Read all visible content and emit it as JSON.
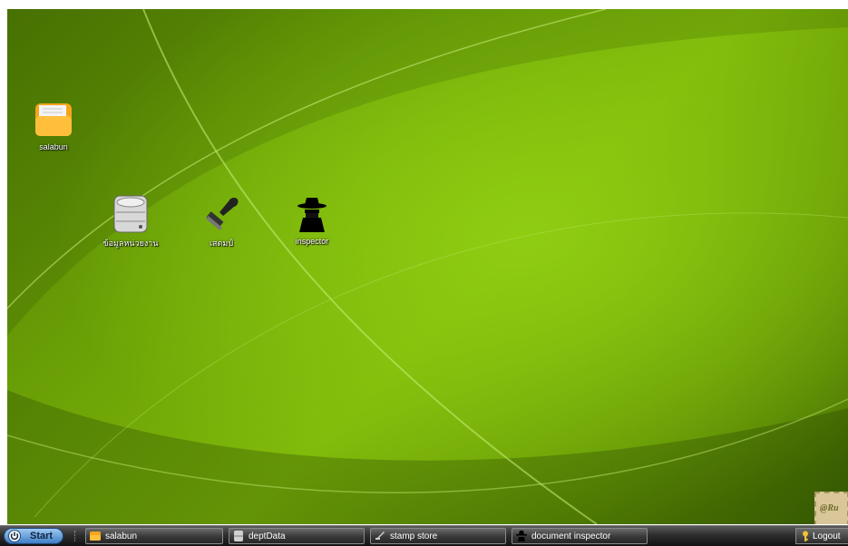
{
  "desktop": {
    "icons": [
      {
        "label": "salabun",
        "icon": "folder-icon"
      },
      {
        "label": "ข้อมูลหน่วยงาน",
        "icon": "database-icon"
      },
      {
        "label": "เสตมป์",
        "icon": "stamp-icon"
      },
      {
        "label": "inspector",
        "icon": "spy-icon"
      }
    ],
    "corner_stamp_text": "@Ru"
  },
  "taskbar": {
    "start_label": "Start",
    "tasks": [
      {
        "label": "salabun",
        "icon": "folder-icon"
      },
      {
        "label": "deptData",
        "icon": "database-icon"
      },
      {
        "label": "stamp store",
        "icon": "stamp-icon"
      },
      {
        "label": "document inspector",
        "icon": "spy-icon"
      }
    ],
    "logout_label": "Logout"
  },
  "colors": {
    "desktop_green": "#7fb80a",
    "taskbar_dark": "#2e2e2e",
    "start_blue": "#3f7fc6"
  }
}
